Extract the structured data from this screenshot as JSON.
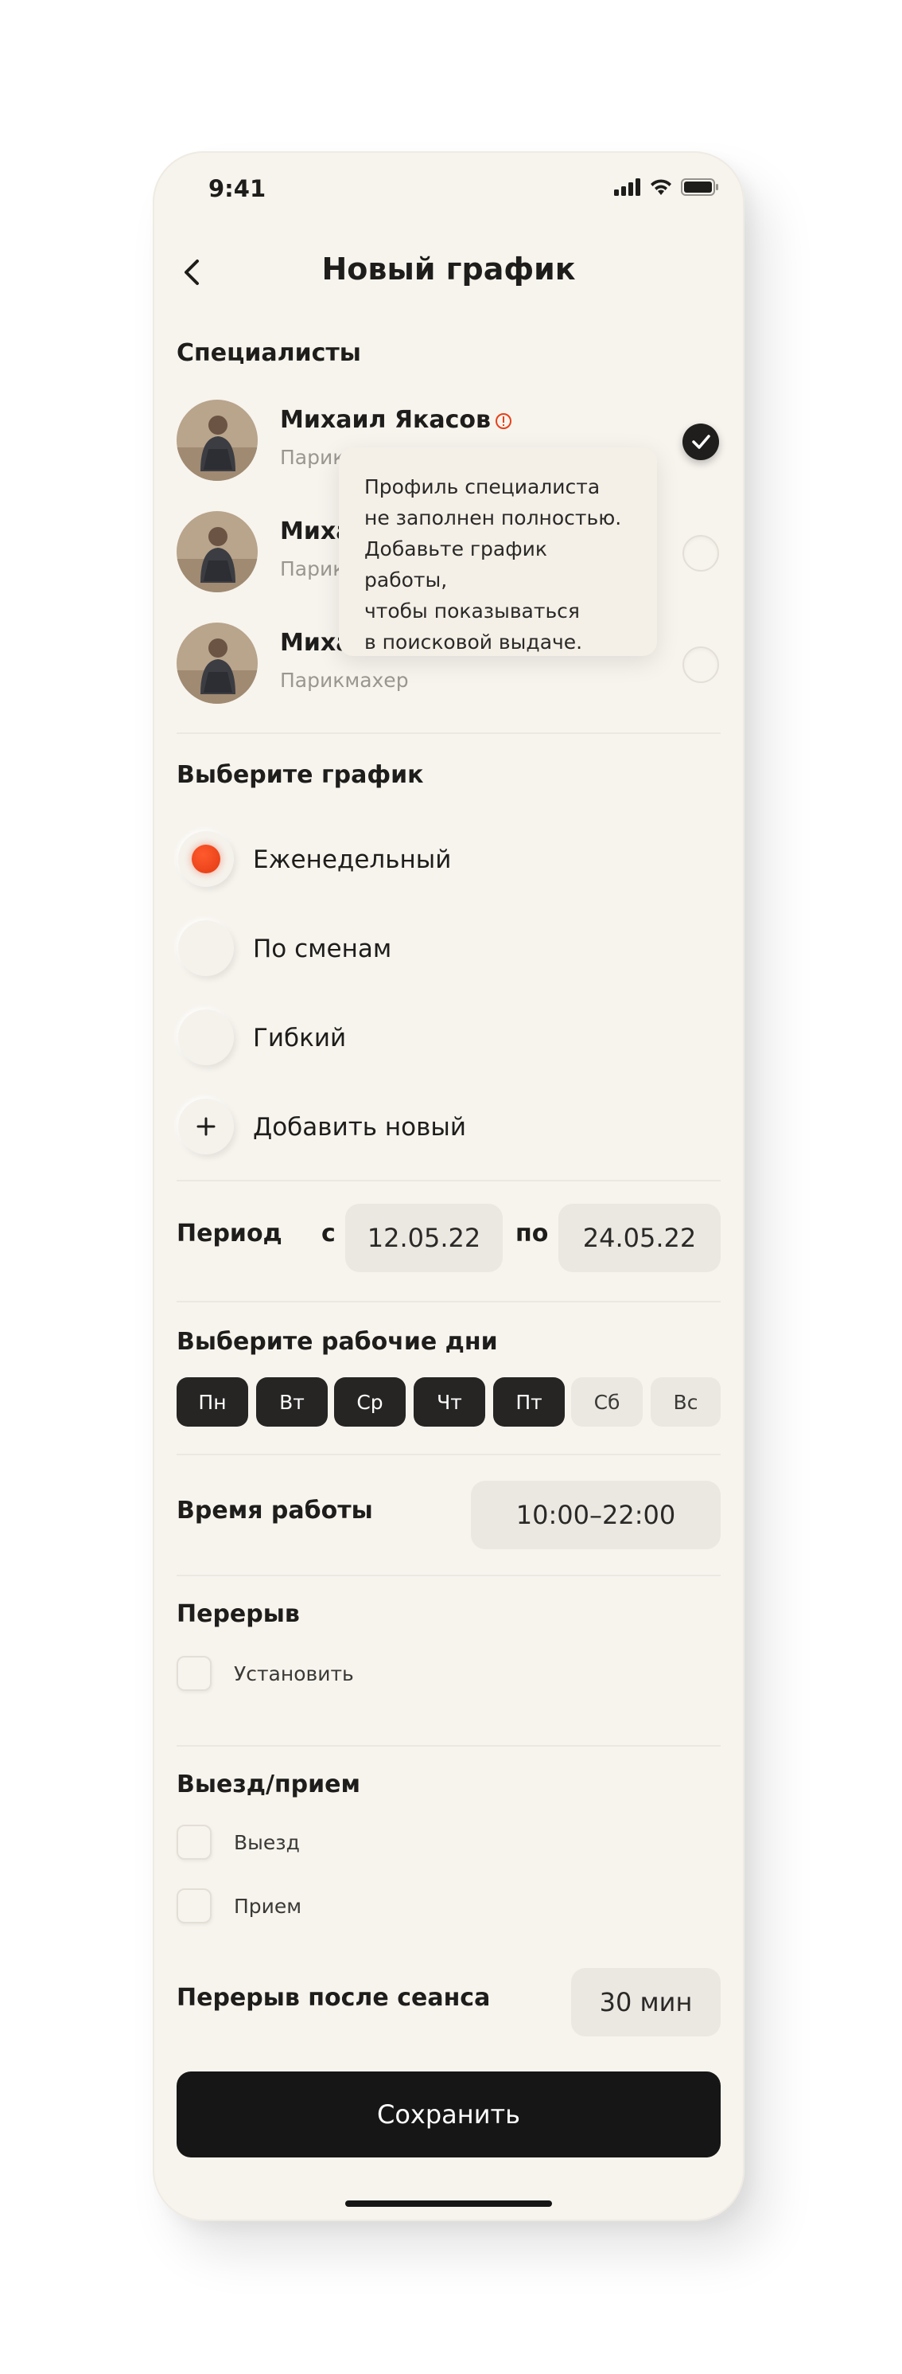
{
  "status_bar": {
    "time": "9:41"
  },
  "header": {
    "title": "Новый график"
  },
  "specialists": {
    "title": "Специалисты",
    "items": [
      {
        "name": "Михаил Якасов",
        "role": "Парикмахер",
        "selected": true,
        "warning": true
      },
      {
        "name": "Михаил Якасов",
        "role": "Парикмахер",
        "selected": false,
        "warning": false
      },
      {
        "name": "Михаил Якасов",
        "role": "Парикмахер",
        "selected": false,
        "warning": false
      }
    ],
    "tooltip": [
      "Профиль специалиста",
      "не заполнен полностью.",
      "Добавьте график работы,",
      "чтобы показываться",
      "в поисковой выдаче."
    ]
  },
  "schedule": {
    "title": "Выберите график",
    "options": [
      {
        "label": "Еженедельный",
        "selected": true
      },
      {
        "label": "По сменам",
        "selected": false
      },
      {
        "label": "Гибкий",
        "selected": false
      }
    ],
    "add_label": "Добавить новый"
  },
  "period": {
    "label": "Период",
    "from_prefix": "с",
    "from": "12.05.22",
    "to_prefix": "по",
    "to": "24.05.22"
  },
  "workdays": {
    "title": "Выберите рабочие дни",
    "days": [
      {
        "label": "Пн",
        "active": true
      },
      {
        "label": "Вт",
        "active": true
      },
      {
        "label": "Ср",
        "active": true
      },
      {
        "label": "Чт",
        "active": true
      },
      {
        "label": "Пт",
        "active": true
      },
      {
        "label": "Сб",
        "active": false
      },
      {
        "label": "Вс",
        "active": false
      }
    ]
  },
  "work_time": {
    "label": "Время работы",
    "value": "10:00–22:00"
  },
  "break": {
    "title": "Перерыв",
    "option": "Установить"
  },
  "visit": {
    "title": "Выезд/прием",
    "options": [
      "Выезд",
      "Прием"
    ]
  },
  "session_break": {
    "label": "Перерыв после сеанса",
    "value": "30 мин"
  },
  "save_label": "Сохранить",
  "colors": {
    "accent": "#e8401a",
    "dark": "#161616",
    "background": "#f7f4ee",
    "pill": "#ebe8e2"
  }
}
